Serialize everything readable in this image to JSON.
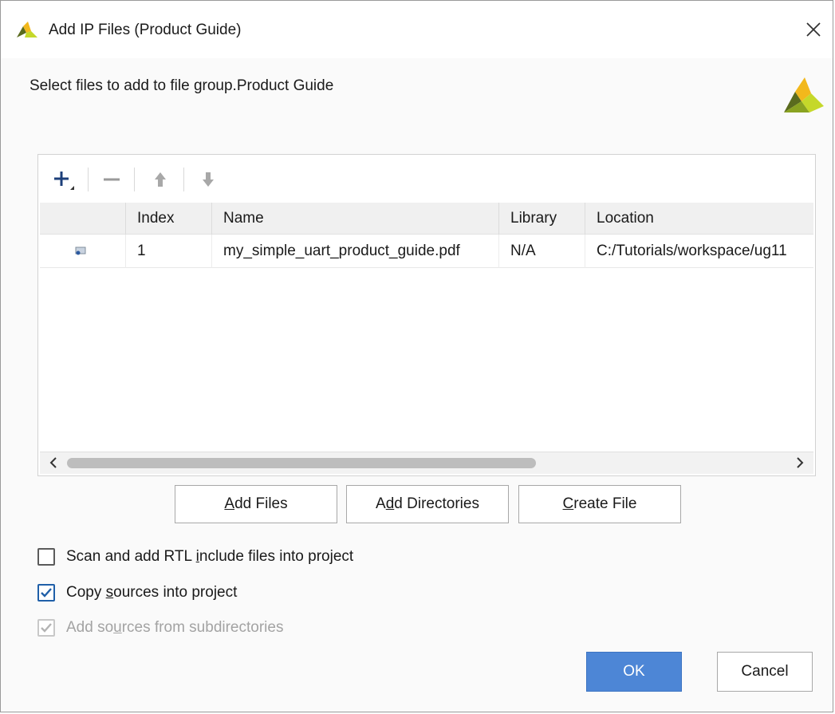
{
  "window": {
    "title": "Add IP Files (Product Guide)",
    "close_glyph": "×",
    "logo_icon": "vivado-logo-icon"
  },
  "header": {
    "subtitle": "Select files to add to file group.Product Guide",
    "logo_icon": "vivado-logo-icon"
  },
  "toolbar": {
    "add_icon": "plus-icon",
    "remove_icon": "minus-icon",
    "up_icon": "arrow-up-icon",
    "down_icon": "arrow-down-icon"
  },
  "table": {
    "columns": [
      "",
      "Index",
      "Name",
      "Library",
      "Location"
    ],
    "rows": [
      {
        "icon": "file-icon",
        "index": "1",
        "name": "my_simple_uart_product_guide.pdf",
        "library": "N/A",
        "location": "C:/Tutorials/workspace/ug11"
      }
    ]
  },
  "buttons": {
    "add_files": {
      "prefix": "",
      "accel": "A",
      "suffix": "dd Files"
    },
    "add_directories": {
      "prefix": "A",
      "accel": "d",
      "suffix": "d Directories"
    },
    "create_file": {
      "prefix": "",
      "accel": "C",
      "suffix": "reate File"
    }
  },
  "options": {
    "scan_rtl": {
      "checked": false,
      "prefix": "Scan and add RTL ",
      "accel": "i",
      "suffix": "nclude files into project"
    },
    "copy_sources": {
      "checked": true,
      "prefix": "Copy ",
      "accel": "s",
      "suffix": "ources into project"
    },
    "subdirs": {
      "checked": true,
      "disabled": true,
      "prefix": "Add so",
      "accel": "u",
      "suffix": "rces from subdirectories"
    }
  },
  "footer": {
    "ok_label": "OK",
    "cancel_label": "Cancel"
  },
  "colors": {
    "accent": "#4d86d6",
    "logo_dark": "#5a6b1e",
    "logo_light": "#c5d82a",
    "logo_mid": "#f2b81c"
  }
}
